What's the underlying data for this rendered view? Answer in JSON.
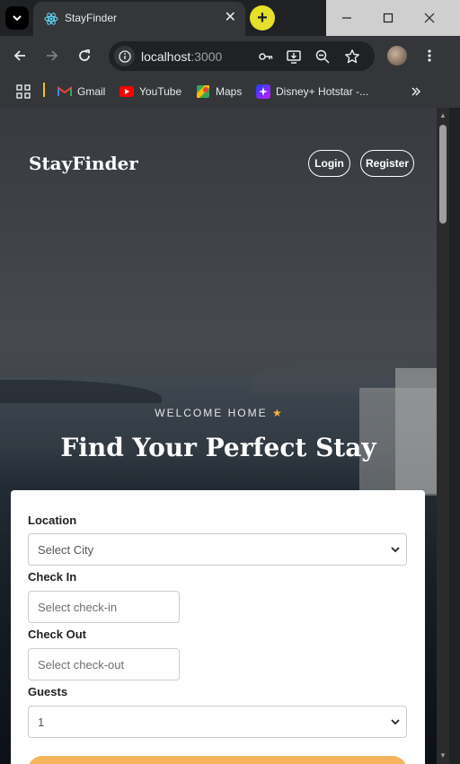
{
  "browser": {
    "tab_title": "StayFinder",
    "tab_close": "✕",
    "new_tab": "+",
    "url_host": "localhost",
    "url_port": ":3000"
  },
  "bookmarks": [
    {
      "label": "Gmail",
      "icon": "gmail-icon"
    },
    {
      "label": "YouTube",
      "icon": "youtube-icon"
    },
    {
      "label": "Maps",
      "icon": "maps-icon"
    },
    {
      "label": "Disney+ Hotstar -...",
      "icon": "hotstar-icon"
    }
  ],
  "site": {
    "brand": "StayFinder",
    "login_label": "Login",
    "register_label": "Register",
    "welcome": "WELCOME HOME",
    "welcome_star": "★",
    "headline": "Find Your Perfect Stay"
  },
  "form": {
    "location_label": "Location",
    "location_value": "Select City",
    "checkin_label": "Check In",
    "checkin_placeholder": "Select check-in",
    "checkout_label": "Check Out",
    "checkout_placeholder": "Select check-out",
    "guests_label": "Guests",
    "guests_value": "1"
  },
  "colors": {
    "accent": "#f5b45c",
    "newtab": "#e4e02b"
  }
}
